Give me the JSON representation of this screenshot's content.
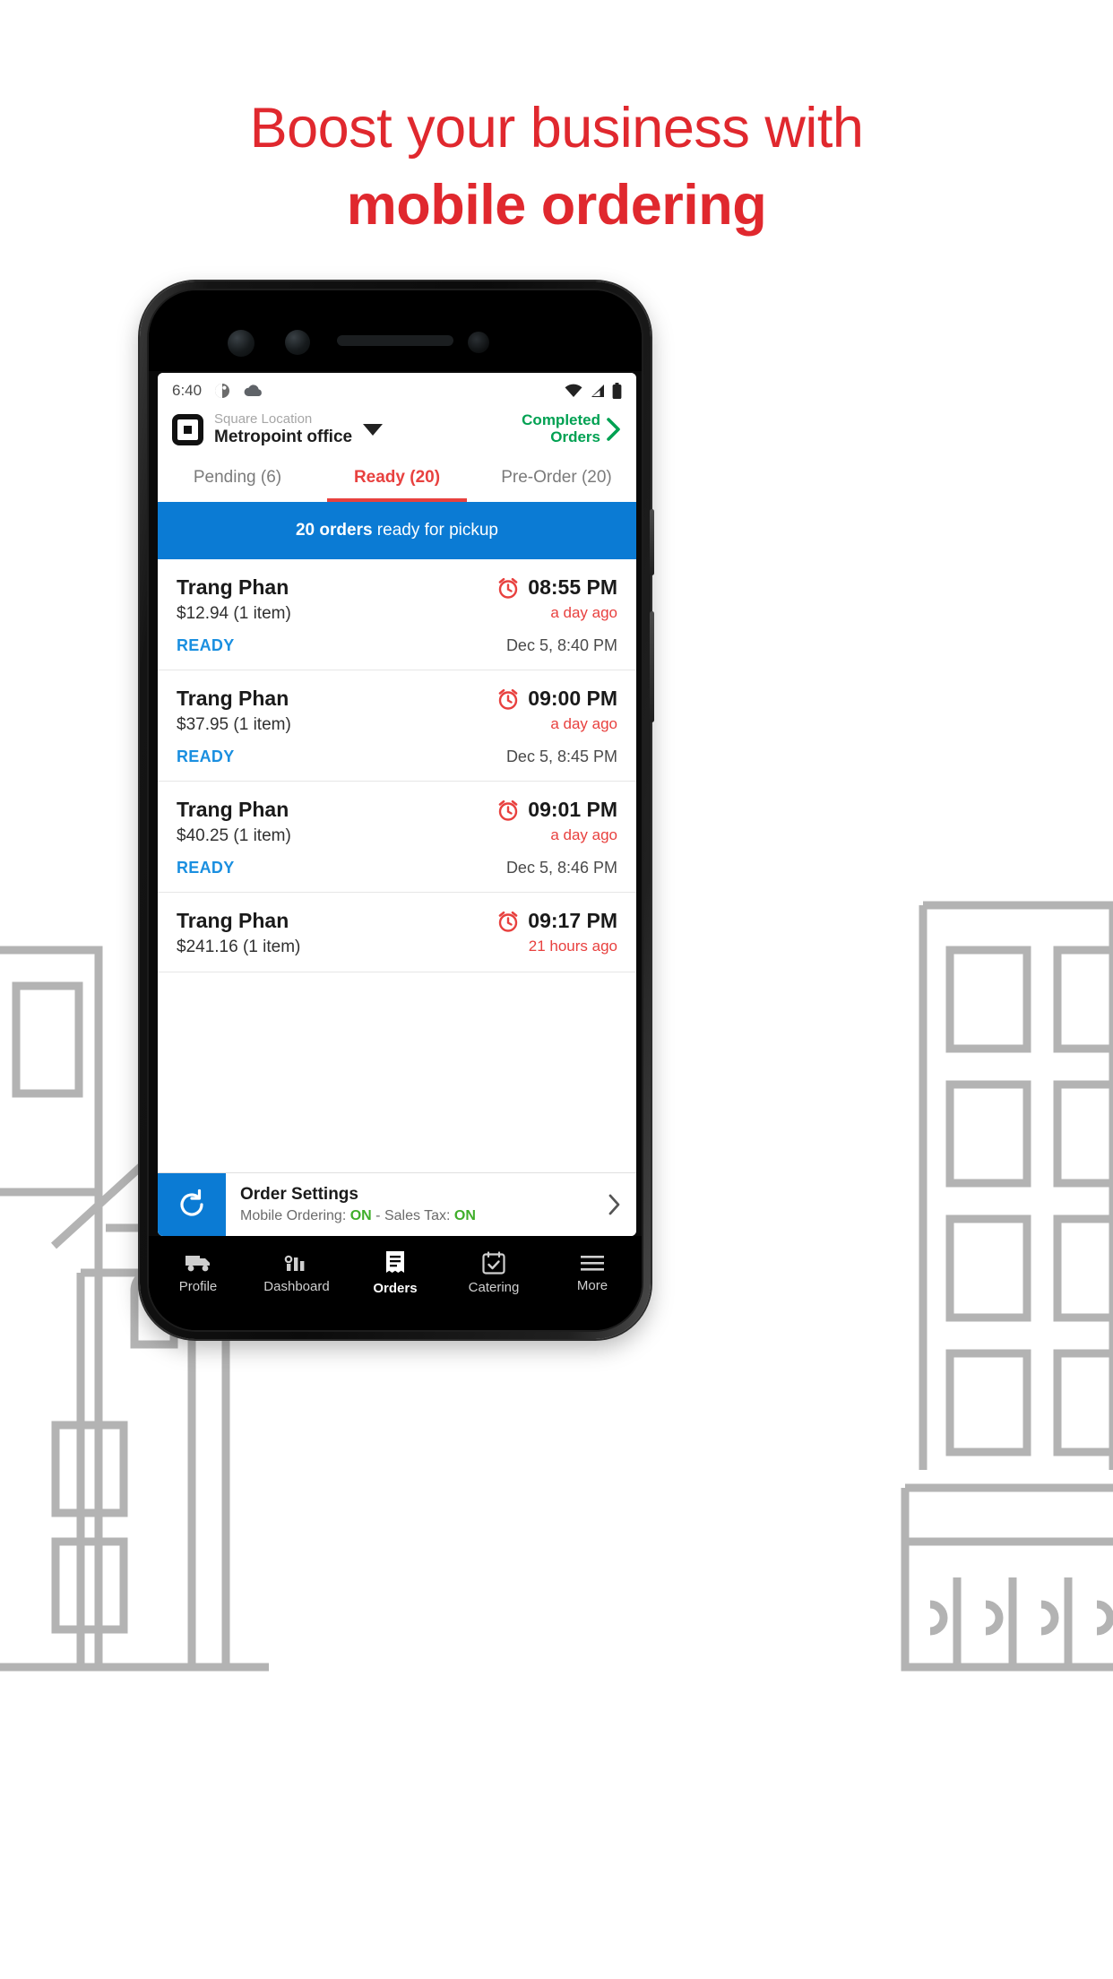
{
  "headline": {
    "line1": "Boost your business with",
    "line2": "mobile ordering",
    "color": "#e0282e"
  },
  "phone": {
    "status_bar": {
      "time": "6:40",
      "icons": [
        "brightness-icon",
        "cloud-icon",
        "wifi-icon",
        "cellular-signal-icon",
        "battery-icon"
      ]
    },
    "app": {
      "header": {
        "logo": "square-logo-icon",
        "location_label": "Square Location",
        "location_name": "Metropoint office",
        "dropdown_icon": "chevron-down-icon",
        "completed_line1": "Completed",
        "completed_line2": "Orders",
        "completed_chevron": "chevron-right-icon",
        "completed_color": "#00a152"
      },
      "tabs": [
        {
          "label": "Pending (6)",
          "active": false
        },
        {
          "label": "Ready (20)",
          "active": true
        },
        {
          "label": "Pre-Order (20)",
          "active": false
        }
      ],
      "banner": {
        "bold": "20 orders",
        "rest": " ready for pickup",
        "bg_color": "#0b7bd4"
      },
      "orders": [
        {
          "name": "Trang Phan",
          "price": "$12.94 (1 item)",
          "time": "08:55 PM",
          "ago": "a day ago",
          "status": "READY",
          "date": "Dec 5, 8:40 PM"
        },
        {
          "name": "Trang Phan",
          "price": "$37.95 (1 item)",
          "time": "09:00 PM",
          "ago": "a day ago",
          "status": "READY",
          "date": "Dec 5, 8:45 PM"
        },
        {
          "name": "Trang Phan",
          "price": "$40.25 (1 item)",
          "time": "09:01 PM",
          "ago": "a day ago",
          "status": "READY",
          "date": "Dec 5, 8:46 PM"
        },
        {
          "name": "Trang Phan",
          "price": "$241.16 (1 item)",
          "time": "09:17 PM",
          "ago": "21 hours ago",
          "status": "",
          "date": ""
        }
      ],
      "order_settings": {
        "icon": "refresh-icon",
        "title": "Order Settings",
        "sub_prefix": "Mobile Ordering: ",
        "sub_on1": "ON",
        "sub_mid": " - Sales Tax: ",
        "sub_on2": "ON",
        "chevron": "chevron-right-icon",
        "on_color": "#3fae2a"
      },
      "bottom_nav": [
        {
          "label": "Profile",
          "icon": "truck-icon",
          "active": false
        },
        {
          "label": "Dashboard",
          "icon": "bar-chart-icon",
          "active": false
        },
        {
          "label": "Orders",
          "icon": "receipt-icon",
          "active": true
        },
        {
          "label": "Catering",
          "icon": "calendar-check-icon",
          "active": false
        },
        {
          "label": "More",
          "icon": "hamburger-menu-icon",
          "active": false
        }
      ]
    }
  }
}
